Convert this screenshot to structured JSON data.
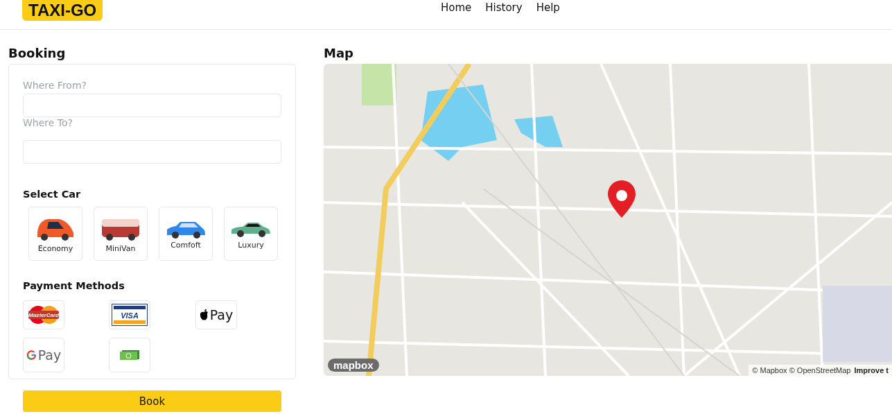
{
  "header": {
    "logo": "TAXI-GO",
    "nav": [
      {
        "label": "Home"
      },
      {
        "label": "History"
      },
      {
        "label": "Help"
      }
    ]
  },
  "booking": {
    "title": "Booking",
    "fields": [
      {
        "label": "Where From?"
      },
      {
        "label": "Where To?"
      }
    ],
    "cars_title": "Select Car",
    "cars": [
      {
        "label": "Economy",
        "kind": "economy",
        "color": "#f05a28"
      },
      {
        "label": "MiniVan",
        "kind": "van",
        "color": "#b83a32"
      },
      {
        "label": "Comfoft",
        "kind": "hatch",
        "color": "#2f86eb"
      },
      {
        "label": "Luxury",
        "kind": "sedan",
        "color": "#5fae8c"
      }
    ],
    "payment_title": "Payment Methods",
    "payments": [
      {
        "kind": "mastercard",
        "label": "MasterCard"
      },
      {
        "kind": "visa",
        "label": "VISA"
      },
      {
        "kind": "applepay",
        "label": "Pay"
      },
      {
        "kind": "gpay",
        "label": "Pay"
      },
      {
        "kind": "cash"
      }
    ],
    "button": "Book"
  },
  "map": {
    "title": "Map",
    "attribution": "© Mapbox © OpenStreetMap",
    "improve": "Improve t",
    "logo": "mapbox"
  }
}
